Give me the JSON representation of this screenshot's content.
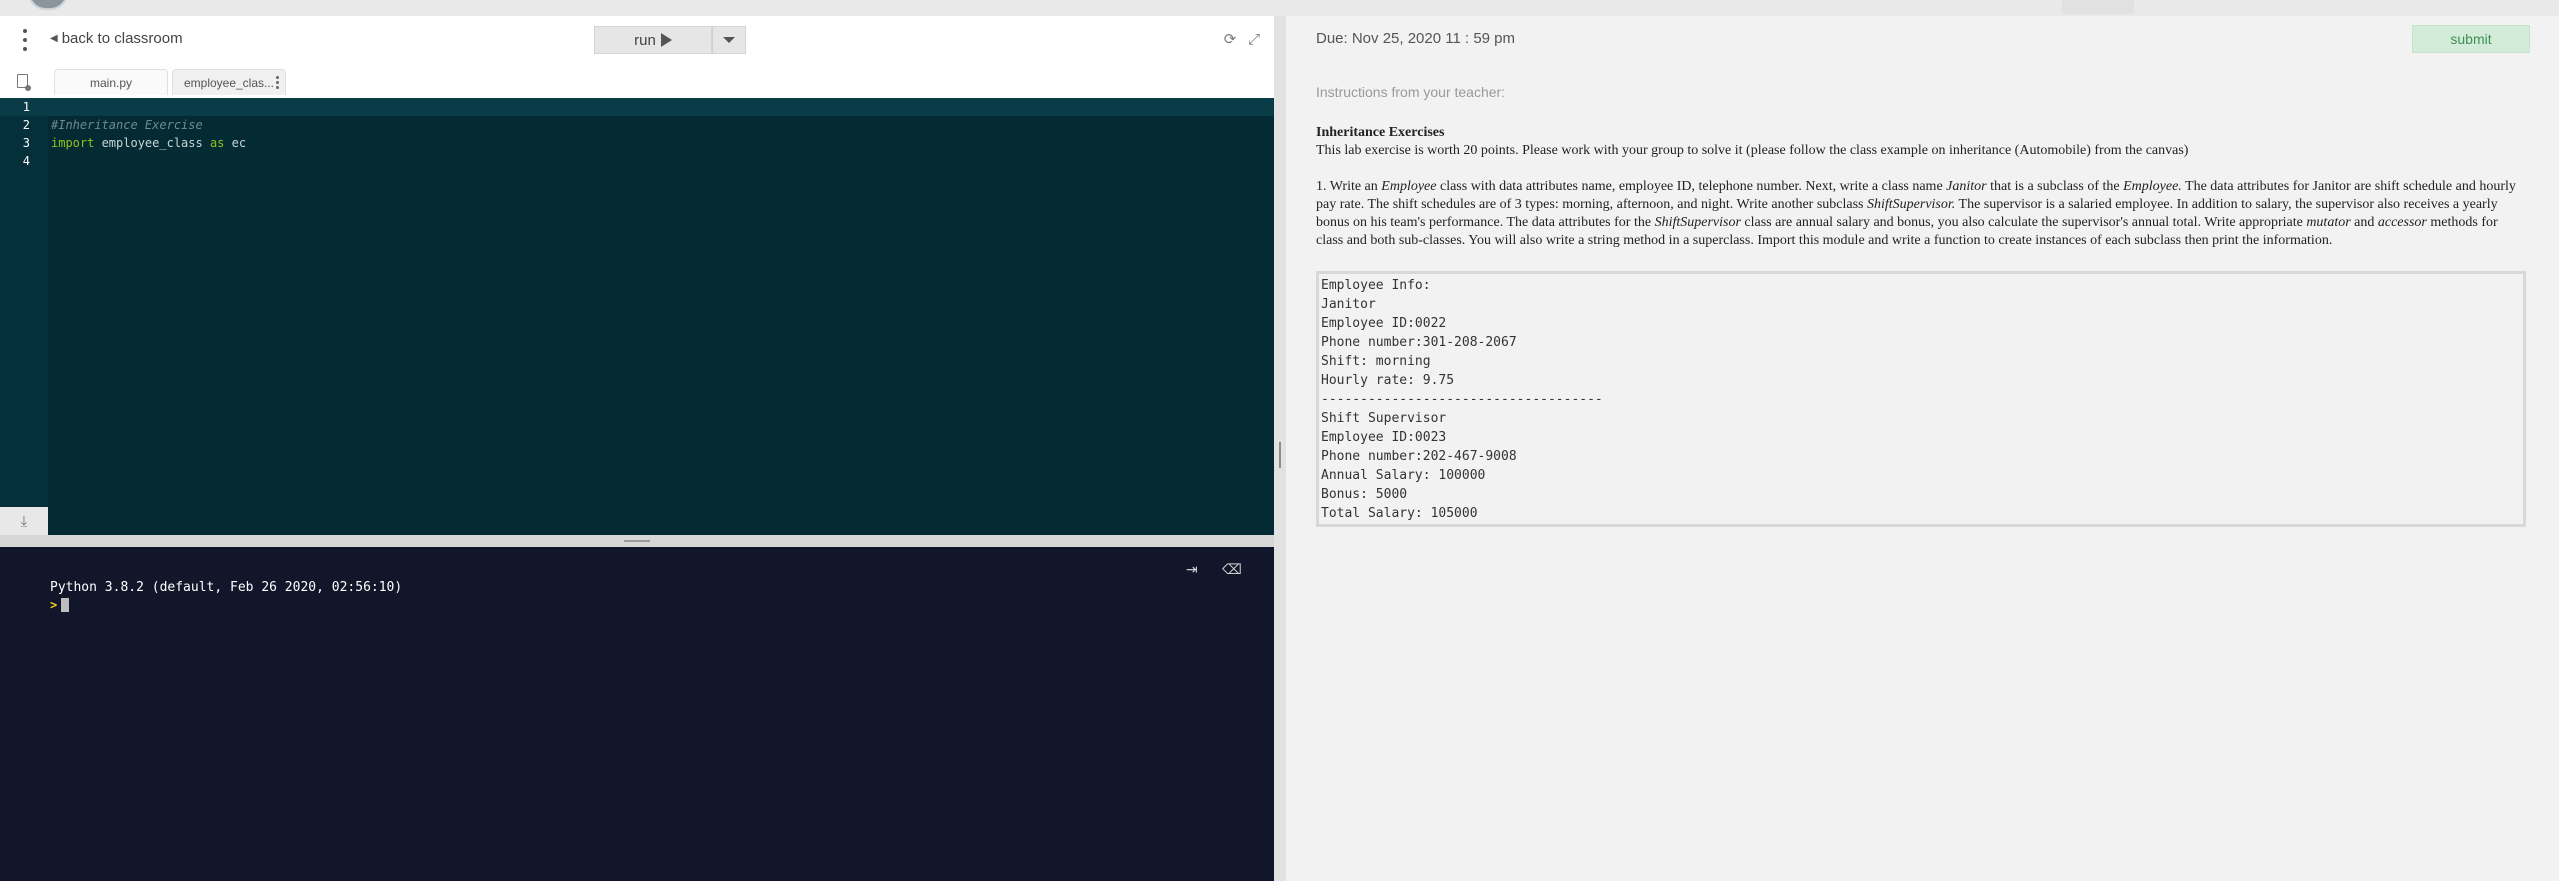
{
  "editor_toolbar": {
    "back_label": "back to classroom",
    "run_label": "run"
  },
  "file_tabs": [
    {
      "label": "main.py"
    },
    {
      "label": "employee_clas..."
    }
  ],
  "code_lines": [
    {
      "num": "1",
      "comment": "",
      "kw": "",
      "rest": "",
      "kw2": "",
      "rest2": ""
    },
    {
      "num": "2",
      "comment": "#Inheritance Exercise",
      "kw": "",
      "rest": "",
      "kw2": "",
      "rest2": ""
    },
    {
      "num": "3",
      "comment": "",
      "kw": "import",
      "rest": " employee_class ",
      "kw2": "as",
      "rest2": " ec"
    },
    {
      "num": "4",
      "comment": "",
      "kw": "",
      "rest": "",
      "kw2": "",
      "rest2": ""
    }
  ],
  "console": {
    "banner": "Python 3.8.2 (default, Feb 26 2020, 02:56:10)",
    "prompt": ">"
  },
  "assignment": {
    "due": "Due: Nov 25, 2020 11 : 59 pm",
    "submit_label": "submit",
    "instructions_label": "Instructions from your teacher:",
    "title": "Inheritance Exercises",
    "intro": "This lab exercise is worth 20 points. Please work with your group to solve it (please follow the class example on inheritance (Automobile) from the canvas)",
    "task": {
      "p1": "1. Write an ",
      "t1": "Employee",
      "p2": " class with data attributes name, employee ID, telephone number. Next, write a class name ",
      "t2": "Janitor",
      "p3": " that is a subclass of the ",
      "t3": "Employee.",
      "p4": " The data attributes for Janitor are shift schedule and hourly pay rate. The shift schedules are of 3 types: morning, afternoon, and night. Write another subclass ",
      "t4": "ShiftSupervisor.",
      "p5": " The supervisor is a salaried employee. In addition to salary, the supervisor also receives a yearly bonus on his team's performance. The data attributes for the ",
      "t5": "ShiftSupervisor",
      "p6": " class are annual salary and bonus, you also calculate the supervisor's annual total. Write appropriate ",
      "t6": "mutator",
      "p7": " and ",
      "t7": "accessor",
      "p8": " methods for class and both sub-classes. You will also write a string method in a superclass. Import this module and write a function to create instances of each subclass then print the information."
    },
    "sample_output": [
      "Employee Info:",
      "Janitor",
      "Employee ID:0022",
      "Phone number:301-208-2067",
      "Shift: morning",
      "Hourly rate: 9.75",
      "------------------------------------",
      "Shift Supervisor",
      "Employee ID:0023",
      "Phone number:202-467-9008",
      "Annual Salary: 100000",
      "Bonus: 5000",
      "Total Salary: 105000"
    ]
  }
}
